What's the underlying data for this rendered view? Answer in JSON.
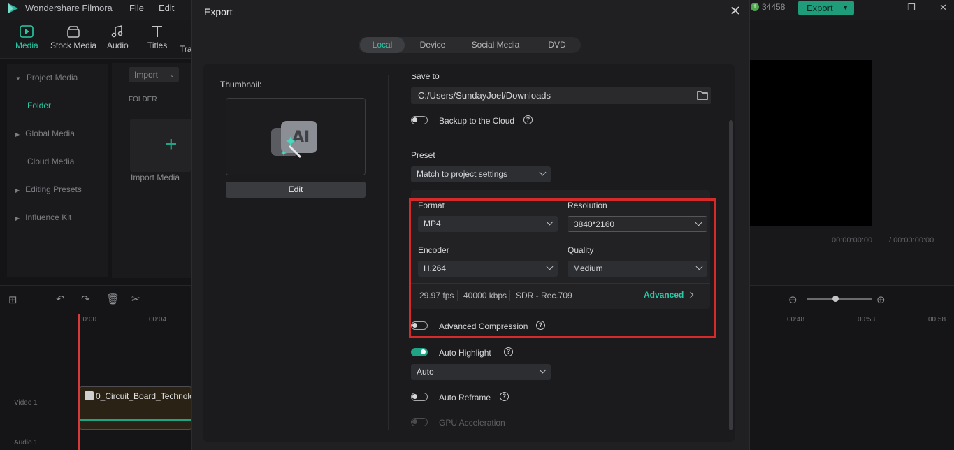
{
  "app": {
    "title": "Wondershare Filmora",
    "menu": [
      "File",
      "Edit"
    ],
    "credits": "34458",
    "export_label": "Export",
    "toolbar": [
      "Media",
      "Stock Media",
      "Audio",
      "Titles",
      "Tra"
    ],
    "sidebar": [
      "Project Media",
      "Folder",
      "Global Media",
      "Cloud Media",
      "Editing Presets",
      "Influence Kit"
    ],
    "import_label": "Import",
    "folder_label": "FOLDER",
    "import_media_label": "Import Media",
    "timecode_current": "00:00:00:00",
    "timecode_total": "/ 00:00:00:00",
    "ruler": [
      "00:00",
      "00:04",
      "00:48",
      "00:53",
      "00:58"
    ],
    "clip_name": "0_Circuit_Board_Technolo",
    "tracks": [
      "Video 1",
      "Audio 1"
    ]
  },
  "dialog": {
    "title": "Export",
    "tabs": [
      "Local",
      "Device",
      "Social Media",
      "DVD"
    ],
    "active_tab": "Local",
    "thumbnail_label": "Thumbnail:",
    "edit_label": "Edit",
    "save_to_label": "Save to",
    "save_path": "C:/Users/SundayJoel/Downloads",
    "backup_label": "Backup to the Cloud",
    "preset_label": "Preset",
    "preset_value": "Match to project settings",
    "format_label": "Format",
    "format_value": "MP4",
    "resolution_label": "Resolution",
    "resolution_value": "3840*2160",
    "encoder_label": "Encoder",
    "encoder_value": "H.264",
    "quality_label": "Quality",
    "quality_value": "Medium",
    "fps": "29.97 fps",
    "bitrate": "40000 kbps",
    "color": "SDR - Rec.709",
    "advanced_label": "Advanced",
    "adv_compression_label": "Advanced Compression",
    "auto_highlight_label": "Auto Highlight",
    "auto_highlight_value": "Auto",
    "auto_reframe_label": "Auto Reframe",
    "gpu_label": "GPU Acceleration",
    "help_glyph": "?",
    "accent_color": "#29c9a6",
    "highlight_box_color": "#d42a2a"
  }
}
